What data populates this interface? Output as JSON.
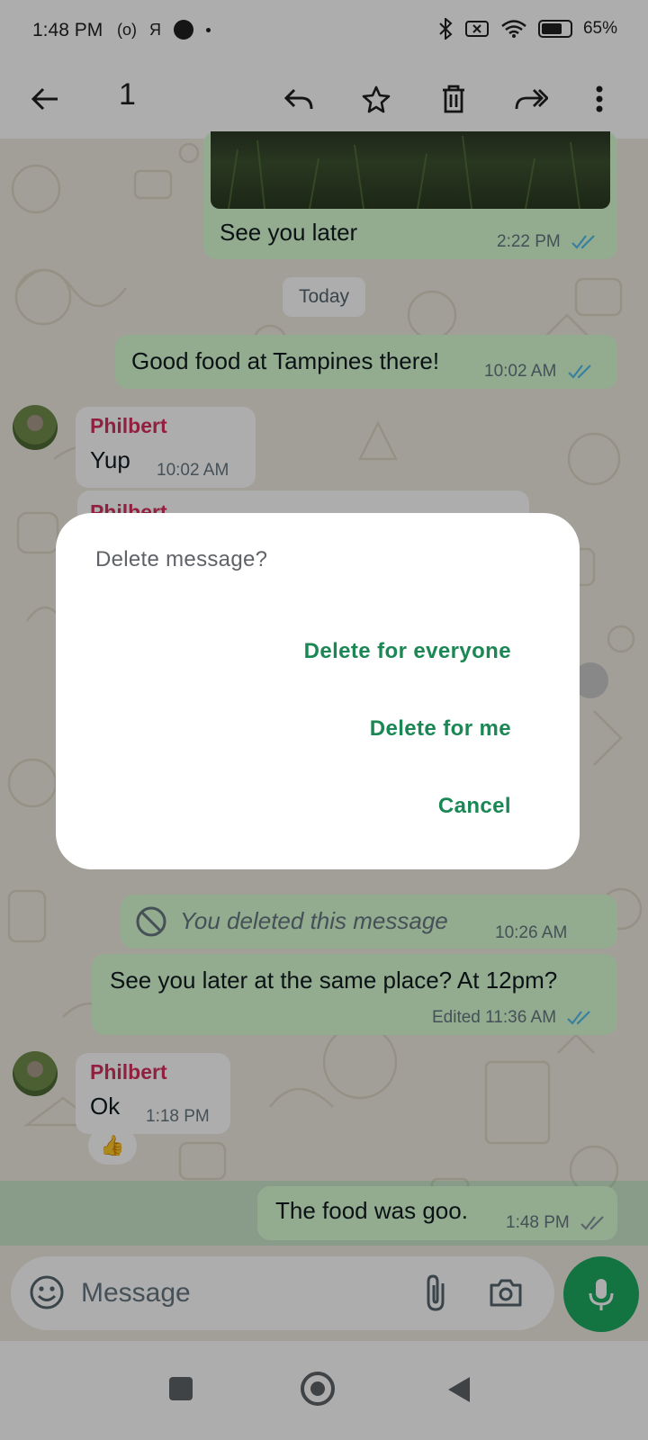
{
  "status_bar": {
    "time": "1:48 PM",
    "network_label": "R",
    "battery": "65%"
  },
  "action_bar": {
    "selected_count": "1",
    "icons": [
      "back-arrow-icon",
      "reply-icon",
      "star-icon",
      "delete-icon",
      "forward-icon",
      "more-vert-icon"
    ]
  },
  "messages": {
    "m1_text": "See you later",
    "m1_time": "2:22 PM",
    "date_chip": "Today",
    "m2_text": "Good food at Tampines there!",
    "m2_time": "10:02 AM",
    "m3_sender": "Philbert",
    "m3_text": "Yup",
    "m3_time": "10:02 AM",
    "m4_sender": "Philbert",
    "m5_text": "You deleted this message",
    "m5_time": "10:26 AM",
    "m6_text": "See you later at the same place? At 12pm?",
    "m6_meta": "Edited 11:36 AM",
    "m7_sender": "Philbert",
    "m7_text": "Ok",
    "m7_time": "1:18 PM",
    "m7_reaction": "👍",
    "m8_text": "The food was goo.",
    "m8_time": "1:48 PM"
  },
  "composer": {
    "placeholder": "Message"
  },
  "dialog": {
    "title": "Delete message?",
    "option_everyone": "Delete for everyone",
    "option_me": "Delete for me",
    "option_cancel": "Cancel"
  },
  "colors": {
    "accent_green": "#1b8755",
    "outgoing_bubble": "#d9fdd3",
    "sender_name": "#d6305f",
    "read_ticks": "#53bdeb",
    "mic_button": "#1daa61"
  }
}
